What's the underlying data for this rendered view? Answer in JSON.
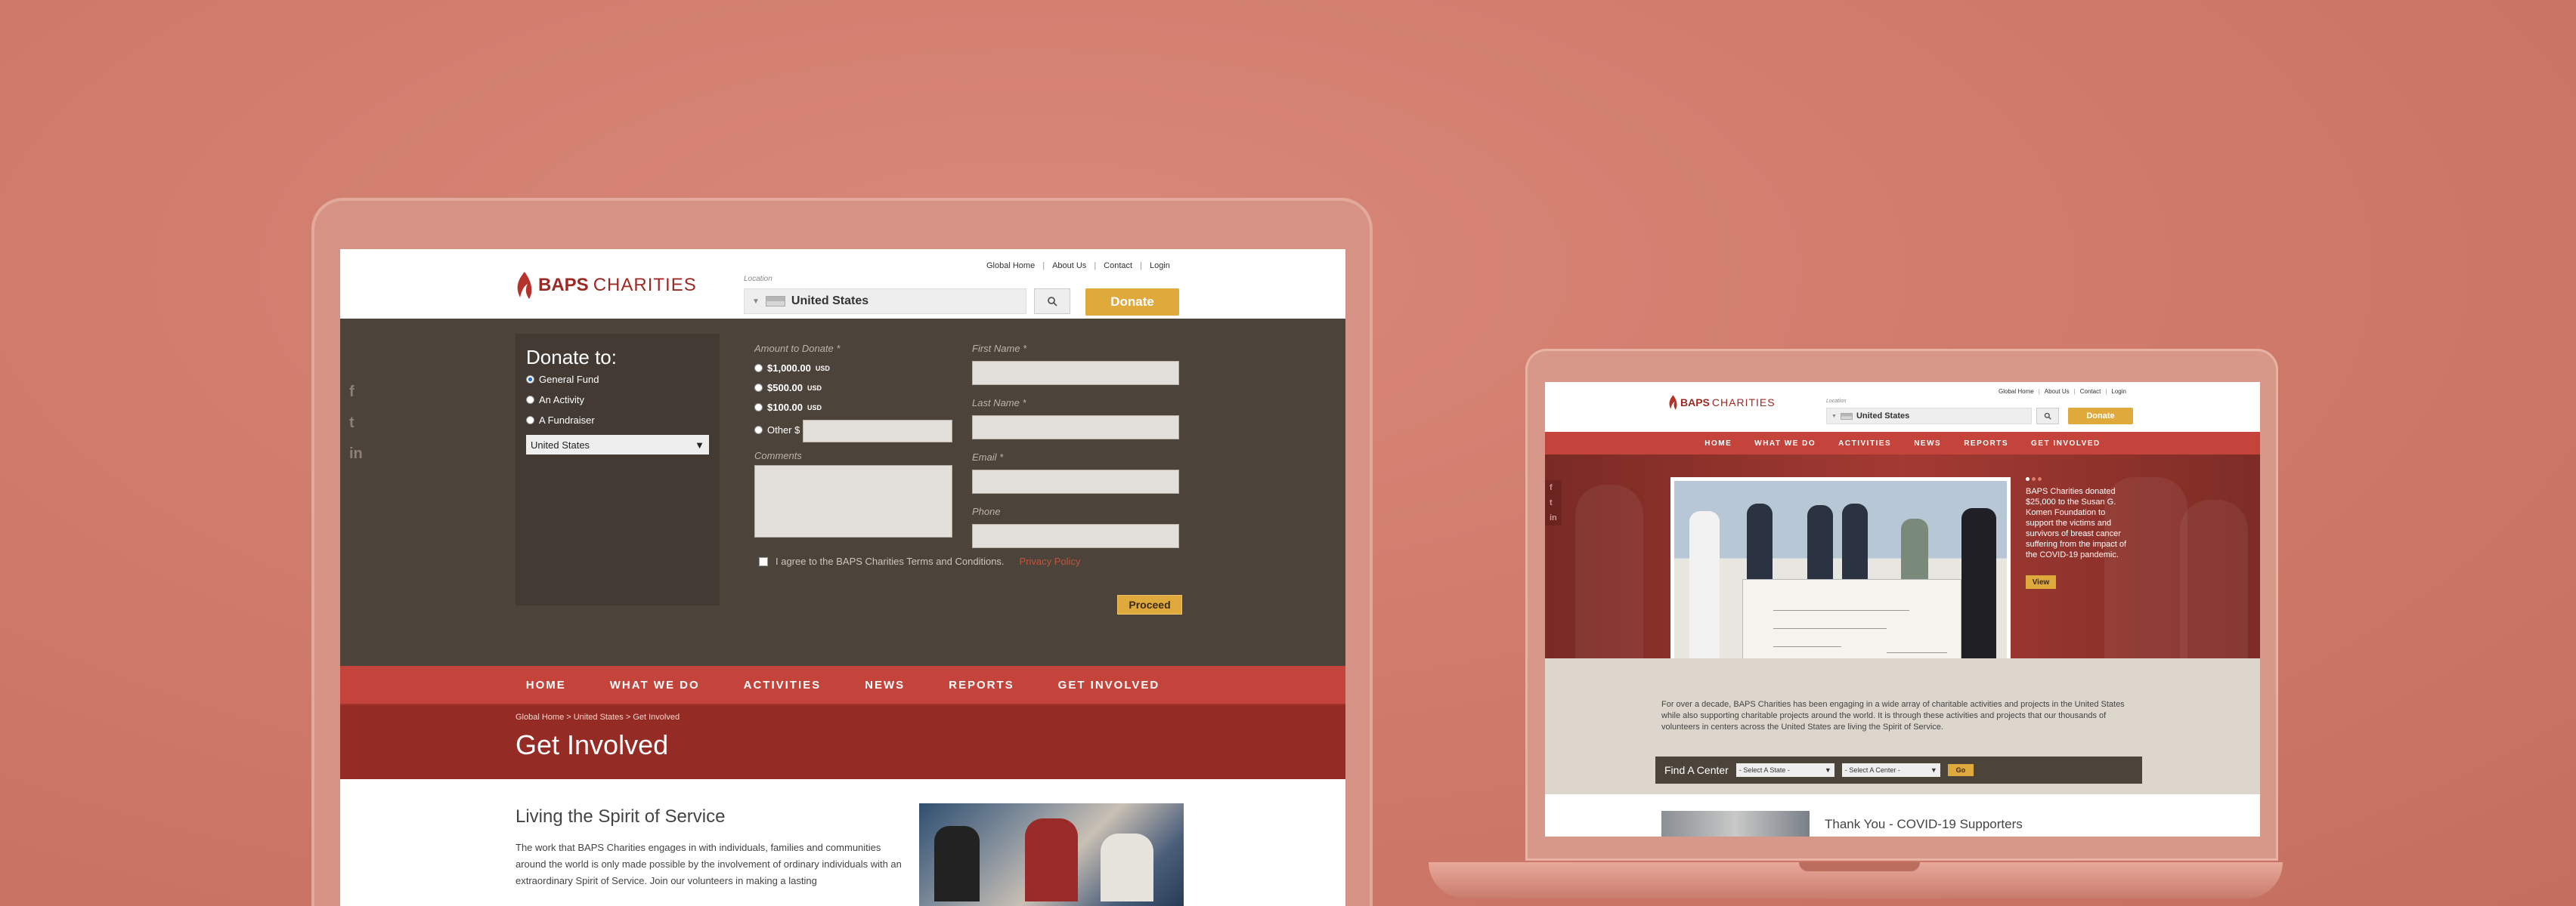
{
  "colors": {
    "background": "#d37e6e",
    "brand_red": "#c4433a",
    "dark_red": "#952b25",
    "dark_panel": "#4c443b",
    "accent_gold": "#e0a93c"
  },
  "site": {
    "brand_bold": "BAPS",
    "brand_light": "CHARITIES"
  },
  "toplinks": [
    "Global Home",
    "About Us",
    "Contact",
    "Login"
  ],
  "location": {
    "label": "Location",
    "value": "United States"
  },
  "donate_label": "Donate",
  "social_icons": [
    "facebook-icon",
    "twitter-icon",
    "linkedin-icon"
  ],
  "donate_form": {
    "title": "Donate to:",
    "targets": [
      "General Fund",
      "An Activity",
      "A Fundraiser"
    ],
    "country": "United States",
    "amount_label": "Amount to Donate *",
    "amounts": [
      "$1,000.00",
      "$500.00",
      "$100.00"
    ],
    "currency": "USD",
    "other_label": "Other $",
    "comments_label": "Comments",
    "first_name_label": "First Name *",
    "last_name_label": "Last Name *",
    "email_label": "Email *",
    "phone_label": "Phone",
    "agree_text": "I agree to the BAPS Charities Terms and Conditions.",
    "privacy_label": "Privacy Policy",
    "proceed_label": "Proceed"
  },
  "nav": [
    "HOME",
    "WHAT WE DO",
    "ACTIVITIES",
    "NEWS",
    "REPORTS",
    "GET INVOLVED"
  ],
  "breadcrumb": "Global Home > United States > Get Involved",
  "page_title": "Get Involved",
  "section": {
    "title": "Living the Spirit of Service",
    "text": "The work that BAPS Charities engages in with individuals, families and communities around the world is only made possible by the involvement of ordinary individuals with an extraordinary Spirit of Service.  Join our volunteers in making a lasting"
  },
  "home_b": {
    "hero_text": "BAPS Charities donated $25,000 to the Susan G. Komen Foundation to support the victims and survivors of breast cancer suffering from the impact of the COVID-19 pandemic.",
    "view_label": "View",
    "about": "For over a decade, BAPS Charities has been engaging in a wide array of charitable activities and projects in the United States while also supporting charitable projects around the world.  It is through these activities and projects that our thousands of volunteers in centers across the United States are living the Spirit of Service.",
    "find_label": "Find A Center",
    "state_select": "- Select A State -",
    "center_select": "- Select A Center -",
    "go_label": "Go",
    "news_title": "Thank You - COVID-19 Supporters"
  }
}
